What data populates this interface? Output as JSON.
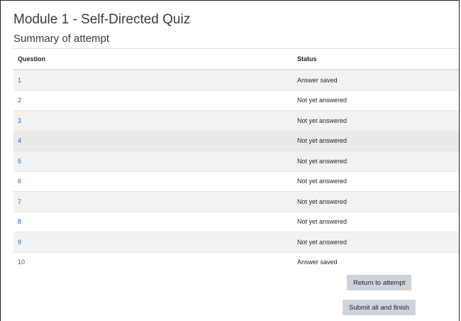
{
  "page": {
    "title": "Module 1 - Self-Directed Quiz",
    "subtitle": "Summary of attempt"
  },
  "table": {
    "headers": {
      "question": "Question",
      "status": "Status"
    },
    "rows": [
      {
        "question": "1",
        "status": "Answer saved"
      },
      {
        "question": "2",
        "status": "Not yet answered"
      },
      {
        "question": "3",
        "status": "Not yet answered"
      },
      {
        "question": "4",
        "status": "Not yet answered"
      },
      {
        "question": "5",
        "status": "Not yet answered"
      },
      {
        "question": "6",
        "status": "Not yet answered"
      },
      {
        "question": "7",
        "status": "Not yet answered"
      },
      {
        "question": "8",
        "status": "Not yet answered"
      },
      {
        "question": "9",
        "status": "Not yet answered"
      },
      {
        "question": "10",
        "status": "Answer saved"
      }
    ]
  },
  "buttons": {
    "return_label": "Return to attempt",
    "submit_label": "Submit all and finish"
  },
  "colors": {
    "link": "#0f6cbf",
    "button_bg": "#ced4da",
    "stripe": "#f2f2f2"
  }
}
